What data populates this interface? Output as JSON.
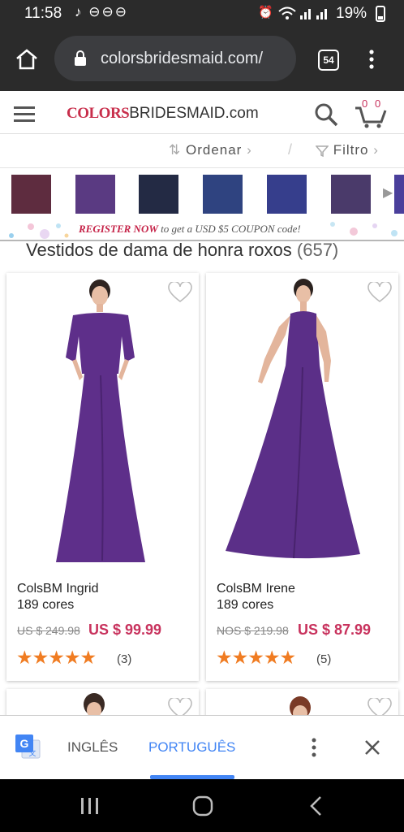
{
  "status_bar": {
    "time": "11:58",
    "notif_icons": "♪ ⊖⊖⊖",
    "battery": "19%"
  },
  "browser": {
    "url": "colorsbridesmaid.com/",
    "tab_count": "54"
  },
  "site": {
    "logo_colors": "COLORS",
    "logo_rest": "BRIDESMAID.com",
    "cart_count": "0"
  },
  "sort": {
    "sort_label": "Ordenar",
    "filter_label": "Filtro"
  },
  "swatches": [
    "#5e2c3f",
    "#5a3a82",
    "#232a44",
    "#2f4380",
    "#363e8c",
    "#4a3a6a",
    "#4a3f9b"
  ],
  "banner": {
    "strong": "REGISTER NOW",
    "rest": " to get a USD $5 COUPON code!"
  },
  "page": {
    "title": "Vestidos de dama de honra roxos",
    "count": "(657)"
  },
  "products": [
    {
      "name": "ColsBM Ingrid",
      "colors": "189 cores",
      "old_price": "US $ 249.98",
      "price": "US $ 99.99",
      "stars": "★★★★★",
      "reviews": "(3)",
      "dress_color": "#5e2f8a"
    },
    {
      "name": "ColsBM Irene",
      "colors": "189 cores",
      "old_price": "NOS $ 219.98",
      "price": "US $ 87.99",
      "stars": "★★★★★",
      "reviews": "(5)",
      "dress_color": "#5b2f88"
    }
  ],
  "translate": {
    "lang_from": "INGLÊS",
    "lang_to": "PORTUGUÊS"
  },
  "colors": {
    "accent_blue": "#4285f4",
    "price_pink": "#c8325d",
    "star_orange": "#f07c22",
    "dark_bar": "#2b2b2b"
  }
}
